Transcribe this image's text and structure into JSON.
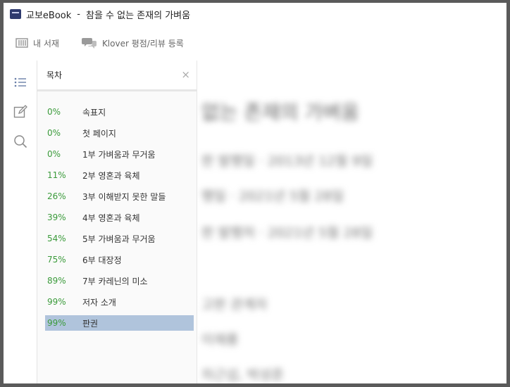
{
  "window": {
    "app_name": "교보eBook",
    "separator": "-",
    "book_title": "참을 수 없는 존재의 가벼움"
  },
  "toolbar": {
    "library_label": "내 서재",
    "review_label": "Klover 평점/리뷰 등록"
  },
  "sidebar": {
    "icons": [
      "list-icon",
      "note-icon",
      "search-icon"
    ]
  },
  "toc": {
    "title": "목차",
    "close": "×",
    "items": [
      {
        "percent": "0%",
        "label": "속표지"
      },
      {
        "percent": "0%",
        "label": "첫 페이지"
      },
      {
        "percent": "0%",
        "label": "1부 가벼움과 무거움"
      },
      {
        "percent": "11%",
        "label": "2부 영혼과 육체"
      },
      {
        "percent": "26%",
        "label": "3부 이해받지 못한 말들"
      },
      {
        "percent": "39%",
        "label": "4부 영혼과 육체"
      },
      {
        "percent": "54%",
        "label": "5부 가벼움과 무거움"
      },
      {
        "percent": "75%",
        "label": "6부 대장정"
      },
      {
        "percent": "89%",
        "label": "7부 카레닌의 미소"
      },
      {
        "percent": "99%",
        "label": "저자 소개"
      },
      {
        "percent": "99%",
        "label": "판권"
      }
    ],
    "selected_index": 10
  },
  "content": {
    "title": "없는 존재의 가벼움",
    "line1": "판 발행일 · 2013년 12월 9일",
    "line2": "행일 · 2021년 5월 28일",
    "line3": "판 발행처 · 2021년 5월 28일",
    "line4": "고판 관계자",
    "line5": "이재룡",
    "line6": "차근섭, 박성준"
  },
  "colors": {
    "percent": "#3a9a3a",
    "selected_row": "#b0c4dc",
    "frame": "#5a5a5a"
  }
}
